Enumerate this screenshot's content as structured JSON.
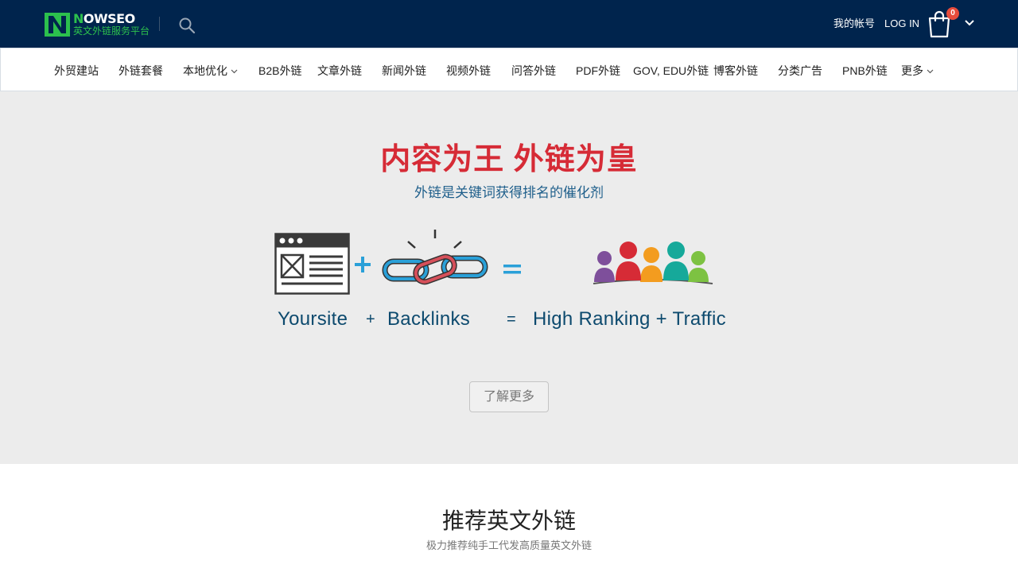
{
  "header": {
    "logo_brand_prefix": "N",
    "logo_brand": "OWSEO",
    "logo_tagline": "英文外链服务平台",
    "account_label": "我的帐号",
    "login_label": "LOG IN",
    "cart_count": "0"
  },
  "nav": {
    "items": [
      {
        "label": "外贸建站"
      },
      {
        "label": "外链套餐"
      },
      {
        "label": "本地优化"
      },
      {
        "label": "B2B外链"
      },
      {
        "label": "文章外链"
      },
      {
        "label": "新闻外链"
      },
      {
        "label": "视频外链"
      },
      {
        "label": "问答外链"
      },
      {
        "label": "PDF外链"
      },
      {
        "label": "GOV, EDU外链"
      },
      {
        "label": "博客外链"
      },
      {
        "label": "分类广告"
      },
      {
        "label": "PNB外链"
      },
      {
        "label": "更多"
      }
    ]
  },
  "hero": {
    "title": "内容为王 外链为皇",
    "subtitle": "外链是关键词获得排名的催化剂",
    "caption_site": "Yoursite",
    "caption_plus": "+",
    "caption_backlinks": "Backlinks",
    "caption_equals": "=",
    "caption_result": "High Ranking + Traffic",
    "button_label": "了解更多"
  },
  "recommend": {
    "title": "推荐英文外链",
    "subtitle": "极力推荐纯手工代发高质量英文外链"
  },
  "colors": {
    "header_bg": "#00244d",
    "brand_green": "#2cc04d",
    "hero_title_red": "#d62b36",
    "accent_blue": "#2aa0d8",
    "badge_red": "#e74c3c"
  }
}
